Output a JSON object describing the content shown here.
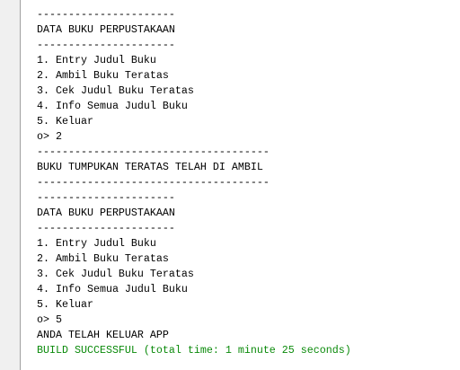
{
  "console": {
    "lines": [
      "----------------------",
      "DATA BUKU PERPUSTAKAAN",
      "----------------------",
      "1. Entry Judul Buku",
      "2. Ambil Buku Teratas",
      "3. Cek Judul Buku Teratas",
      "4. Info Semua Judul Buku",
      "5. Keluar",
      "o> 2",
      "-------------------------------------",
      "BUKU TUMPUKAN TERATAS TELAH DI AMBIL",
      "-------------------------------------",
      "----------------------",
      "DATA BUKU PERPUSTAKAAN",
      "----------------------",
      "1. Entry Judul Buku",
      "2. Ambil Buku Teratas",
      "3. Cek Judul Buku Teratas",
      "4. Info Semua Judul Buku",
      "5. Keluar",
      "o> 5",
      "ANDA TELAH KELUAR APP"
    ],
    "build_status": "BUILD SUCCESSFUL (total time: 1 minute 25 seconds)",
    "build_status_color": "#0a8a0a"
  }
}
